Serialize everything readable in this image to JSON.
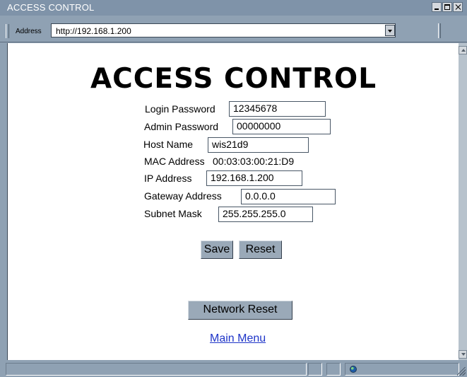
{
  "window": {
    "title": "ACCESS CONTROL"
  },
  "address_bar": {
    "label": "Address",
    "url": "http://192.168.1.200"
  },
  "page": {
    "heading": "ACCESS CONTROL",
    "fields": {
      "login_password": {
        "label": "Login Password",
        "value": "12345678"
      },
      "admin_password": {
        "label": "Admin Password",
        "value": "00000000"
      },
      "host_name": {
        "label": "Host Name",
        "value": "wis21d9"
      },
      "mac_address": {
        "label": "MAC Address",
        "value": "00:03:03:00:21:D9"
      },
      "ip_address": {
        "label": "IP Address",
        "value": "192.168.1.200"
      },
      "gateway_address": {
        "label": "Gateway Address",
        "value": "0.0.0.0"
      },
      "subnet_mask": {
        "label": "Subnet Mask",
        "value": "255.255.255.0"
      }
    },
    "buttons": {
      "save": "Save",
      "reset": "Reset",
      "network_reset": "Network Reset"
    },
    "links": {
      "main_menu": "Main Menu"
    }
  },
  "icons": {
    "status": "globe-icon"
  }
}
